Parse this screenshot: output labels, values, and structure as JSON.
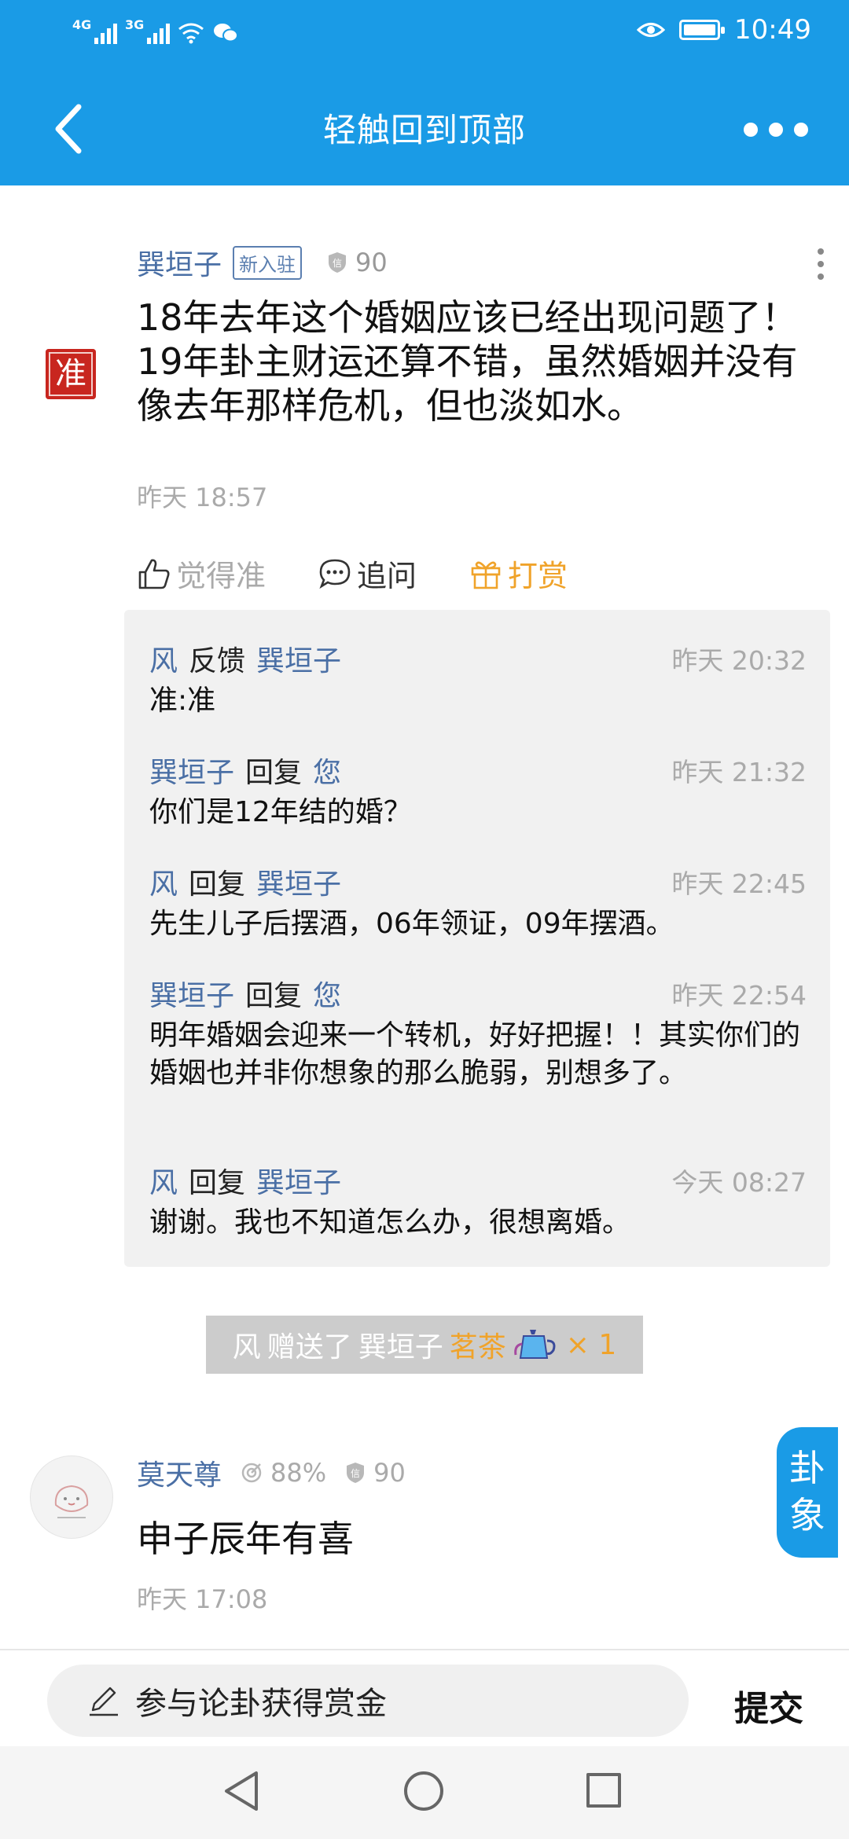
{
  "status_bar": {
    "sim1": "4G",
    "sim2": "3G",
    "time": "10:49"
  },
  "header": {
    "title": "轻触回到顶部"
  },
  "post1": {
    "author": "巽垣子",
    "badge": "新入驻",
    "credit": "90",
    "seal_text": "准",
    "content": "18年去年这个婚姻应该已经出现问题了！19年卦主财运还算不错，虽然婚姻并没有像去年那样危机，但也淡如水。",
    "time": "昨天 18:57",
    "actions": {
      "like": "觉得准",
      "ask": "追问",
      "reward": "打赏"
    }
  },
  "replies": [
    {
      "from": "风",
      "verb": "反馈",
      "to": "巽垣子",
      "time": "昨天 20:32",
      "content": "准:准"
    },
    {
      "from": "巽垣子",
      "verb": "回复",
      "to": "您",
      "time": "昨天 21:32",
      "content": "你们是12年结的婚？"
    },
    {
      "from": "风",
      "verb": "回复",
      "to": "巽垣子",
      "time": "昨天 22:45",
      "content": "先生儿子后摆酒，06年领证，09年摆酒。"
    },
    {
      "from": "巽垣子",
      "verb": "回复",
      "to": "您",
      "time": "昨天 22:54",
      "content": "明年婚姻会迎来一个转机，好好把握！！其实你们的婚姻也并非你想象的那么脆弱，别想多了。"
    },
    {
      "from": "风",
      "verb": "回复",
      "to": "巽垣子",
      "time": "今天 08:27",
      "content": "谢谢。我也不知道怎么办，很想离婚。"
    }
  ],
  "gift": {
    "from": "风",
    "verb": "赠送了",
    "to": "巽垣子",
    "item": "茗茶",
    "count": "× 1"
  },
  "post2": {
    "author": "莫天尊",
    "accuracy": "88%",
    "credit": "90",
    "content": "申子辰年有喜",
    "time": "昨天 17:08"
  },
  "float_button": {
    "line1": "卦",
    "line2": "象"
  },
  "bottom": {
    "input_placeholder": "参与论卦获得赏金",
    "submit_label": "提交"
  },
  "colors": {
    "primary": "#1a9be6",
    "name_link": "#4a6fa5",
    "reward": "#f0a32a",
    "seal": "#c8261f"
  }
}
